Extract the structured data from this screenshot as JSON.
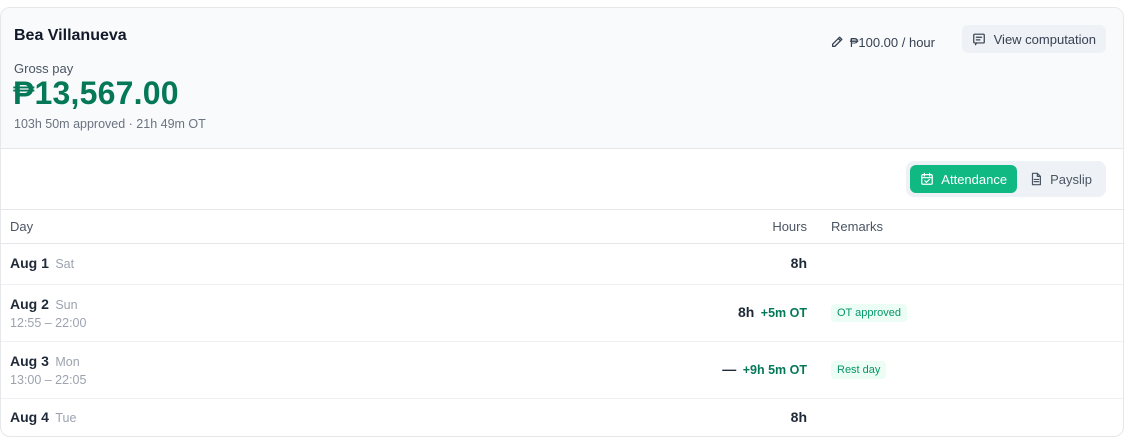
{
  "employee": {
    "name": "Bea Villanueva",
    "gross_label": "Gross pay",
    "gross_amount": "₱13,567.00",
    "summary": "103h 50m approved · 21h 49m OT"
  },
  "rate": {
    "label": "₱100.00 / hour",
    "icon": "pencil-icon"
  },
  "view_computation": {
    "label": "View computation",
    "icon": "receipt-icon"
  },
  "tabs": [
    {
      "label": "Attendance",
      "icon": "calendar-check-icon",
      "active": true
    },
    {
      "label": "Payslip",
      "icon": "document-icon",
      "active": false
    }
  ],
  "table": {
    "headers": {
      "day": "Day",
      "hours": "Hours",
      "remarks": "Remarks"
    },
    "rows": [
      {
        "date": "Aug 1",
        "weekday": "Sat",
        "time": "",
        "hours": "8h",
        "ot": "",
        "remark": ""
      },
      {
        "date": "Aug 2",
        "weekday": "Sun",
        "time": "12:55 – 22:00",
        "hours": "8h",
        "ot": "+5m OT",
        "remark": "OT approved"
      },
      {
        "date": "Aug 3",
        "weekday": "Mon",
        "time": "13:00 – 22:05",
        "hours": "—",
        "ot": "+9h 5m OT",
        "remark": "Rest day"
      },
      {
        "date": "Aug 4",
        "weekday": "Tue",
        "time": "",
        "hours": "8h",
        "ot": "",
        "remark": ""
      }
    ]
  },
  "colors": {
    "accent": "#10b981",
    "money": "#047857",
    "badge_bg": "#ecfdf5"
  }
}
